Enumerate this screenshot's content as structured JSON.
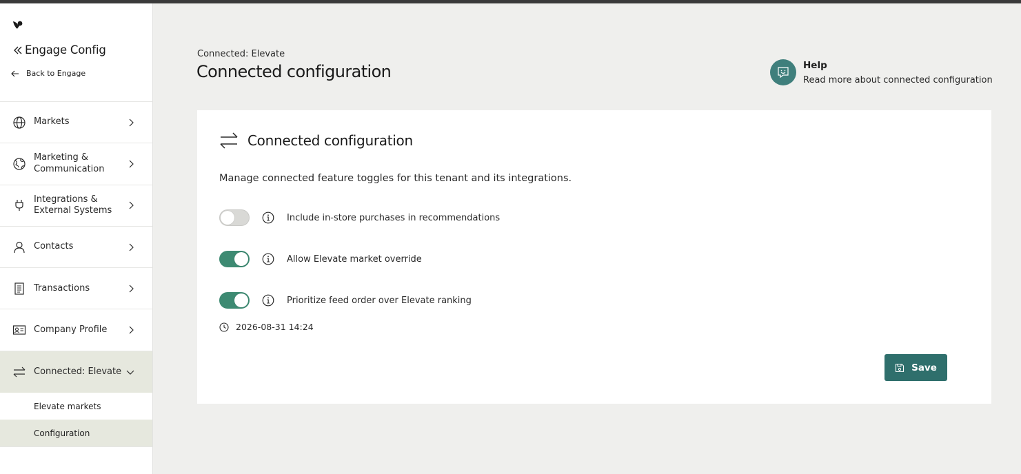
{
  "app": {
    "title": "Engage Config",
    "back_label": "Back to Engage"
  },
  "sidebar": {
    "items": [
      {
        "label": "Markets",
        "icon": "globe-icon"
      },
      {
        "label": "Marketing &\nCommunication",
        "icon": "world-icon"
      },
      {
        "label": "Integrations &\nExternal Systems",
        "icon": "plug-icon"
      },
      {
        "label": "Contacts",
        "icon": "person-icon"
      },
      {
        "label": "Transactions",
        "icon": "receipt-icon"
      },
      {
        "label": "Company Profile",
        "icon": "id-card-icon"
      },
      {
        "label": "Connected: Elevate",
        "icon": "arrows-exchange-icon",
        "expanded": true
      }
    ],
    "subitems": [
      {
        "label": "Elevate markets",
        "selected": false
      },
      {
        "label": "Configuration",
        "selected": true
      }
    ]
  },
  "header": {
    "breadcrumb": "Connected: Elevate",
    "title": "Connected configuration"
  },
  "help": {
    "title": "Help",
    "description": "Read more about connected configuration"
  },
  "card": {
    "title": "Connected configuration",
    "description": "Manage connected feature toggles for this tenant and its integrations.",
    "toggles": [
      {
        "label": "Include in-store purchases in recommendations",
        "on": false
      },
      {
        "label": "Allow Elevate market override",
        "on": true
      },
      {
        "label": "Prioritize feed order over Elevate ranking",
        "on": true
      }
    ],
    "timestamp": "2026-08-31 14:24",
    "save_label": "Save"
  },
  "colors": {
    "accent": "#2f6f6c",
    "toggle_on": "#3d8a72",
    "active_nav_bg": "#e6e8de",
    "page_bg": "#efefed"
  }
}
